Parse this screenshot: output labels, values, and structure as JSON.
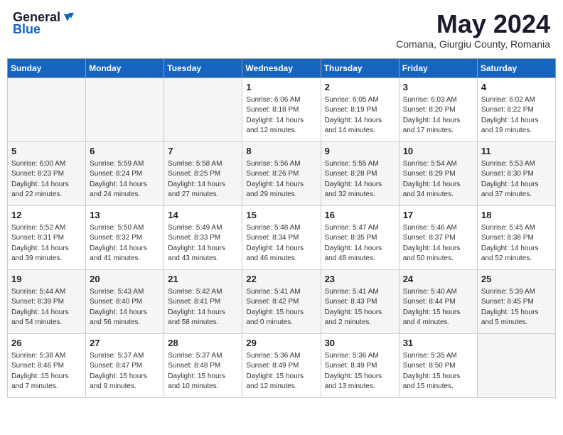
{
  "header": {
    "logo_general": "General",
    "logo_blue": "Blue",
    "month_title": "May 2024",
    "location": "Comana, Giurgiu County, Romania"
  },
  "weekdays": [
    "Sunday",
    "Monday",
    "Tuesday",
    "Wednesday",
    "Thursday",
    "Friday",
    "Saturday"
  ],
  "weeks": [
    [
      {
        "day": "",
        "info": ""
      },
      {
        "day": "",
        "info": ""
      },
      {
        "day": "",
        "info": ""
      },
      {
        "day": "1",
        "info": "Sunrise: 6:06 AM\nSunset: 8:18 PM\nDaylight: 14 hours\nand 12 minutes."
      },
      {
        "day": "2",
        "info": "Sunrise: 6:05 AM\nSunset: 8:19 PM\nDaylight: 14 hours\nand 14 minutes."
      },
      {
        "day": "3",
        "info": "Sunrise: 6:03 AM\nSunset: 8:20 PM\nDaylight: 14 hours\nand 17 minutes."
      },
      {
        "day": "4",
        "info": "Sunrise: 6:02 AM\nSunset: 8:22 PM\nDaylight: 14 hours\nand 19 minutes."
      }
    ],
    [
      {
        "day": "5",
        "info": "Sunrise: 6:00 AM\nSunset: 8:23 PM\nDaylight: 14 hours\nand 22 minutes."
      },
      {
        "day": "6",
        "info": "Sunrise: 5:59 AM\nSunset: 8:24 PM\nDaylight: 14 hours\nand 24 minutes."
      },
      {
        "day": "7",
        "info": "Sunrise: 5:58 AM\nSunset: 8:25 PM\nDaylight: 14 hours\nand 27 minutes."
      },
      {
        "day": "8",
        "info": "Sunrise: 5:56 AM\nSunset: 8:26 PM\nDaylight: 14 hours\nand 29 minutes."
      },
      {
        "day": "9",
        "info": "Sunrise: 5:55 AM\nSunset: 8:28 PM\nDaylight: 14 hours\nand 32 minutes."
      },
      {
        "day": "10",
        "info": "Sunrise: 5:54 AM\nSunset: 8:29 PM\nDaylight: 14 hours\nand 34 minutes."
      },
      {
        "day": "11",
        "info": "Sunrise: 5:53 AM\nSunset: 8:30 PM\nDaylight: 14 hours\nand 37 minutes."
      }
    ],
    [
      {
        "day": "12",
        "info": "Sunrise: 5:52 AM\nSunset: 8:31 PM\nDaylight: 14 hours\nand 39 minutes."
      },
      {
        "day": "13",
        "info": "Sunrise: 5:50 AM\nSunset: 8:32 PM\nDaylight: 14 hours\nand 41 minutes."
      },
      {
        "day": "14",
        "info": "Sunrise: 5:49 AM\nSunset: 8:33 PM\nDaylight: 14 hours\nand 43 minutes."
      },
      {
        "day": "15",
        "info": "Sunrise: 5:48 AM\nSunset: 8:34 PM\nDaylight: 14 hours\nand 46 minutes."
      },
      {
        "day": "16",
        "info": "Sunrise: 5:47 AM\nSunset: 8:35 PM\nDaylight: 14 hours\nand 48 minutes."
      },
      {
        "day": "17",
        "info": "Sunrise: 5:46 AM\nSunset: 8:37 PM\nDaylight: 14 hours\nand 50 minutes."
      },
      {
        "day": "18",
        "info": "Sunrise: 5:45 AM\nSunset: 8:38 PM\nDaylight: 14 hours\nand 52 minutes."
      }
    ],
    [
      {
        "day": "19",
        "info": "Sunrise: 5:44 AM\nSunset: 8:39 PM\nDaylight: 14 hours\nand 54 minutes."
      },
      {
        "day": "20",
        "info": "Sunrise: 5:43 AM\nSunset: 8:40 PM\nDaylight: 14 hours\nand 56 minutes."
      },
      {
        "day": "21",
        "info": "Sunrise: 5:42 AM\nSunset: 8:41 PM\nDaylight: 14 hours\nand 58 minutes."
      },
      {
        "day": "22",
        "info": "Sunrise: 5:41 AM\nSunset: 8:42 PM\nDaylight: 15 hours\nand 0 minutes."
      },
      {
        "day": "23",
        "info": "Sunrise: 5:41 AM\nSunset: 8:43 PM\nDaylight: 15 hours\nand 2 minutes."
      },
      {
        "day": "24",
        "info": "Sunrise: 5:40 AM\nSunset: 8:44 PM\nDaylight: 15 hours\nand 4 minutes."
      },
      {
        "day": "25",
        "info": "Sunrise: 5:39 AM\nSunset: 8:45 PM\nDaylight: 15 hours\nand 5 minutes."
      }
    ],
    [
      {
        "day": "26",
        "info": "Sunrise: 5:38 AM\nSunset: 8:46 PM\nDaylight: 15 hours\nand 7 minutes."
      },
      {
        "day": "27",
        "info": "Sunrise: 5:37 AM\nSunset: 8:47 PM\nDaylight: 15 hours\nand 9 minutes."
      },
      {
        "day": "28",
        "info": "Sunrise: 5:37 AM\nSunset: 8:48 PM\nDaylight: 15 hours\nand 10 minutes."
      },
      {
        "day": "29",
        "info": "Sunrise: 5:36 AM\nSunset: 8:49 PM\nDaylight: 15 hours\nand 12 minutes."
      },
      {
        "day": "30",
        "info": "Sunrise: 5:36 AM\nSunset: 8:49 PM\nDaylight: 15 hours\nand 13 minutes."
      },
      {
        "day": "31",
        "info": "Sunrise: 5:35 AM\nSunset: 8:50 PM\nDaylight: 15 hours\nand 15 minutes."
      },
      {
        "day": "",
        "info": ""
      }
    ]
  ]
}
